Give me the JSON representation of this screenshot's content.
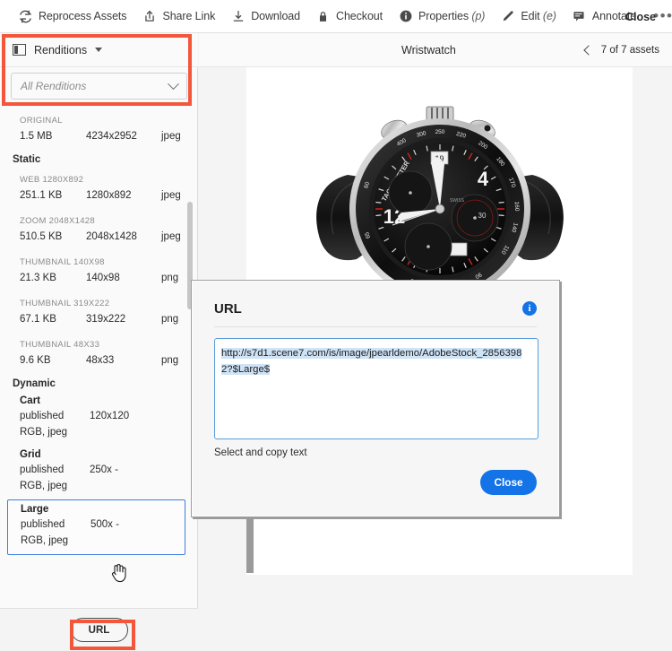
{
  "toolbar": {
    "items": [
      {
        "label": "Reprocess Assets",
        "icon": "refresh-icon",
        "suffix": ""
      },
      {
        "label": "Share Link",
        "icon": "share-icon",
        "suffix": ""
      },
      {
        "label": "Download",
        "icon": "download-icon",
        "suffix": ""
      },
      {
        "label": "Checkout",
        "icon": "lock-icon",
        "suffix": ""
      },
      {
        "label": "Properties",
        "icon": "info-icon",
        "suffix": "(p)"
      },
      {
        "label": "Edit",
        "icon": "pencil-icon",
        "suffix": "(e)"
      },
      {
        "label": "Annotate",
        "icon": "annotate-icon",
        "suffix": ""
      }
    ],
    "overflow_label": "•••",
    "close_label": "Close"
  },
  "sidebar": {
    "panel_title": "Renditions",
    "filter_value": "All Renditions",
    "filter_placeholder": "All Renditions",
    "original_group": {
      "name": "ORIGINAL",
      "size": "1.5 MB",
      "dimensions": "4234x2952",
      "format": "jpeg"
    },
    "static_group_label": "Static",
    "static_renditions": [
      {
        "name": "WEB 1280X892",
        "size": "251.1 KB",
        "dimensions": "1280x892",
        "format": "jpeg"
      },
      {
        "name": "ZOOM 2048X1428",
        "size": "510.5 KB",
        "dimensions": "2048x1428",
        "format": "jpeg"
      },
      {
        "name": "THUMBNAIL 140X98",
        "size": "21.3 KB",
        "dimensions": "140x98",
        "format": "png"
      },
      {
        "name": "THUMBNAIL 319X222",
        "size": "67.1 KB",
        "dimensions": "319x222",
        "format": "png"
      },
      {
        "name": "THUMBNAIL 48X33",
        "size": "9.6 KB",
        "dimensions": "48x33",
        "format": "png"
      }
    ],
    "dynamic_group_label": "Dynamic",
    "dynamic_renditions": [
      {
        "name": "Cart",
        "status": "published",
        "dimensions": "120x120",
        "format": "RGB, jpeg",
        "selected": false
      },
      {
        "name": "Grid",
        "status": "published",
        "dimensions": "250x -",
        "format": "RGB, jpeg",
        "selected": false
      },
      {
        "name": "Large",
        "status": "published",
        "dimensions": "500x -",
        "format": "RGB, jpeg",
        "selected": true
      }
    ],
    "url_button_label": "URL"
  },
  "main": {
    "title": "Wristwatch",
    "asset_counter": "7 of 7 assets",
    "prev_icon": "chevron-left-icon"
  },
  "modal": {
    "title": "URL",
    "info_icon": "info-icon",
    "url_value": "http://s7d1.scene7.com/is/image/jpearldemo/AdobeStock_28563982?$Large$",
    "hint": "Select and copy text",
    "close_label": "Close"
  },
  "colors": {
    "accent_blue": "#1473e6",
    "annotation_red": "#f4563c",
    "selection_blue": "#cfe3f7",
    "selected_border": "#3c7de0"
  }
}
